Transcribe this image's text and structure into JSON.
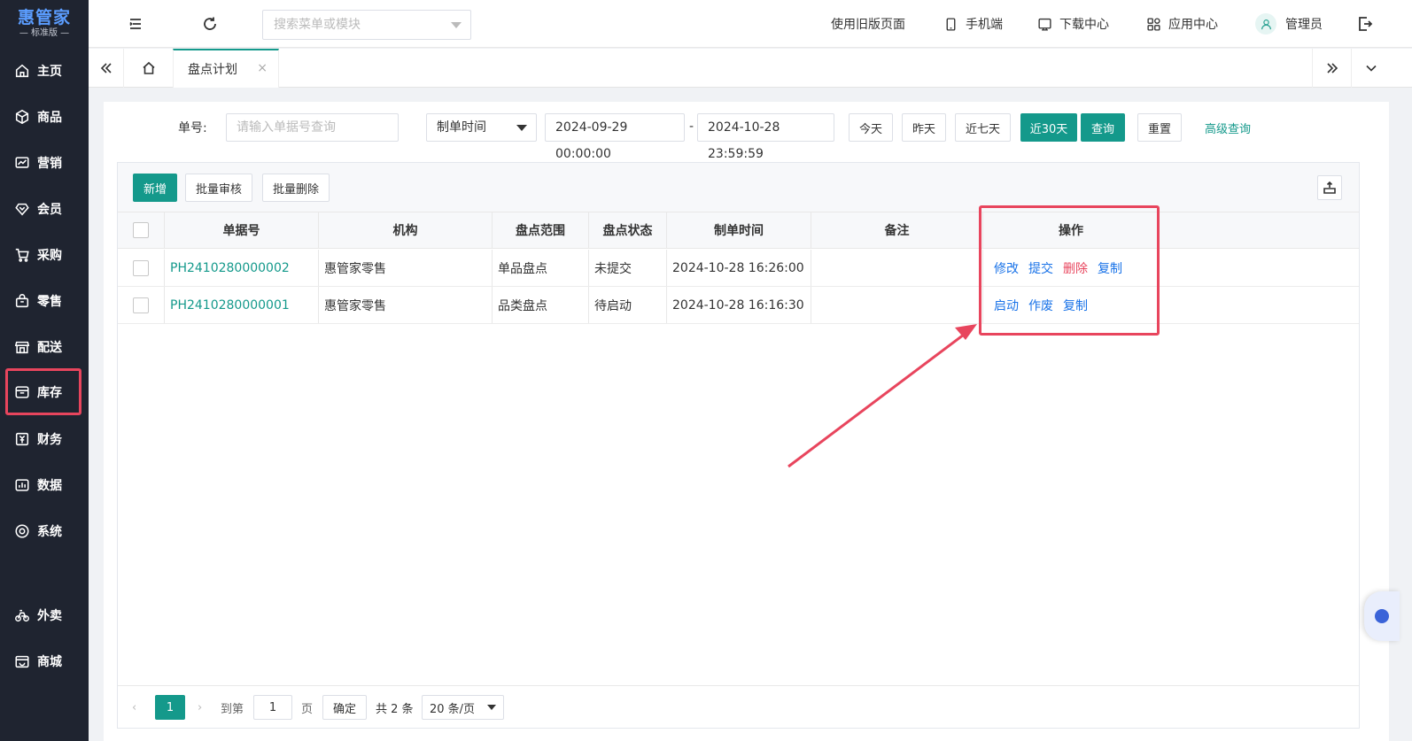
{
  "brand": {
    "title": "惠管家",
    "subtitle": "— 标准版 —"
  },
  "sidebar": {
    "items": [
      {
        "label": "主页",
        "icon": "home-icon"
      },
      {
        "label": "商品",
        "icon": "box-icon"
      },
      {
        "label": "营销",
        "icon": "chart-icon"
      },
      {
        "label": "会员",
        "icon": "diamond-icon"
      },
      {
        "label": "采购",
        "icon": "cart-icon"
      },
      {
        "label": "零售",
        "icon": "bag-icon"
      },
      {
        "label": "配送",
        "icon": "store-icon"
      },
      {
        "label": "库存",
        "icon": "inventory-icon",
        "active": true
      },
      {
        "label": "财务",
        "icon": "finance-icon"
      },
      {
        "label": "数据",
        "icon": "data-icon"
      },
      {
        "label": "系统",
        "icon": "settings-icon"
      },
      {
        "label": "外卖",
        "icon": "bike-icon"
      },
      {
        "label": "商城",
        "icon": "shop-icon"
      }
    ]
  },
  "topbar": {
    "search_placeholder": "搜索菜单或模块",
    "old_page": "使用旧版页面",
    "mobile": "手机端",
    "download": "下载中心",
    "apps": "应用中心",
    "user": "管理员"
  },
  "tabs": [
    {
      "label": "盘点计划",
      "close": "×"
    }
  ],
  "filters": {
    "order_no_label": "单号:",
    "order_no_placeholder": "请输入单据号查询",
    "time_type": "制单时间",
    "start": "2024-09-29 00:00:00",
    "dash": "-",
    "end": "2024-10-28 23:59:59",
    "today": "今天",
    "yesterday": "昨天",
    "last7": "近七天",
    "last30": "近30天",
    "query": "查询",
    "reset": "重置",
    "advanced": "高级查询"
  },
  "toolbar": {
    "add": "新增",
    "batch_audit": "批量审核",
    "batch_delete": "批量删除"
  },
  "table": {
    "headers": [
      "单据号",
      "机构",
      "盘点范围",
      "盘点状态",
      "制单时间",
      "备注",
      "操作"
    ],
    "rows": [
      {
        "no": "PH2410280000002",
        "org": "惠管家零售",
        "scope": "单品盘点",
        "status": "未提交",
        "time": "2024-10-28 16:26:00",
        "note": "",
        "ops": [
          "修改",
          "提交",
          "删除",
          "复制"
        ]
      },
      {
        "no": "PH2410280000001",
        "org": "惠管家零售",
        "scope": "品类盘点",
        "status": "待启动",
        "time": "2024-10-28 16:16:30",
        "note": "",
        "ops": [
          "启动",
          "作废",
          "复制"
        ]
      }
    ]
  },
  "pager": {
    "current": "1",
    "goto_label": "到第",
    "goto_value": "1",
    "page_unit": "页",
    "confirm": "确定",
    "total": "共 2 条",
    "page_size": "20 条/页"
  },
  "colors": {
    "accent": "#14998b",
    "highlight": "#e8455d",
    "link": "#1a73e8",
    "sidebar": "#1f2430"
  }
}
